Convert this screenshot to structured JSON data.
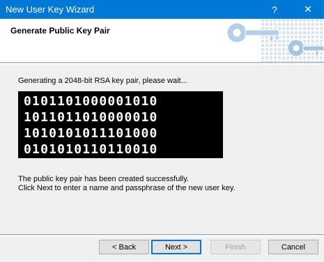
{
  "window": {
    "title": "New User Key Wizard",
    "help_label": "?",
    "close_label": "✕"
  },
  "header": {
    "title": "Generate Public Key Pair",
    "graphic": "keys-graphic"
  },
  "main": {
    "status": "Generating a 2048-bit RSA key pair, please wait...",
    "binary_lines": [
      "0101101000001010",
      "1011011010000010",
      "1010101011101000",
      "0101010110110010"
    ],
    "result_lines": [
      "The public key pair has been created successfully.",
      "Click Next to enter a name and passphrase of the new user key."
    ]
  },
  "buttons": {
    "back": "< Back",
    "next": "Next >",
    "finish": "Finish",
    "cancel": "Cancel"
  },
  "colors": {
    "titlebar": "#0078d7",
    "dialog_bg": "#f0f0f0",
    "binary_bg": "#000000",
    "binary_fg": "#ffffff",
    "key_graphic": "#b7cfe6"
  }
}
